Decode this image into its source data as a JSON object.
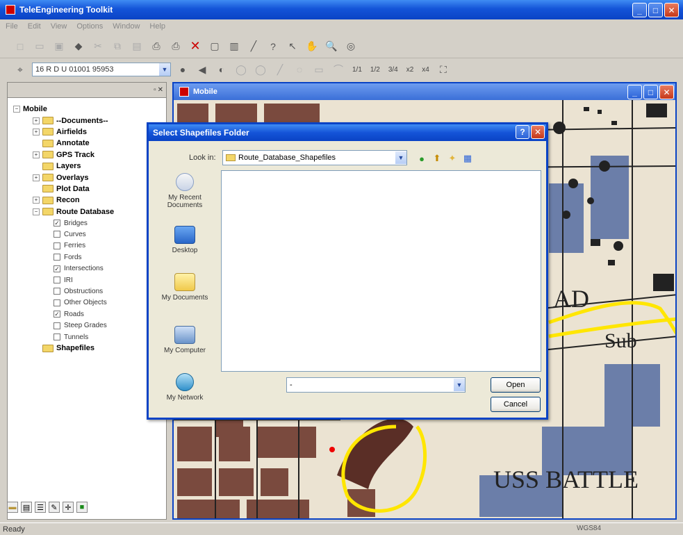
{
  "app": {
    "title": "TeleEngineering Toolkit",
    "menu": [
      "File",
      "Edit",
      "View",
      "Options",
      "Window",
      "Help"
    ]
  },
  "toolbar": {
    "grid_coordinate": "16 R D U 01001 95953",
    "zoom_levels": [
      "1/1",
      "1/2",
      "3/4",
      "x2",
      "x4"
    ]
  },
  "tree": {
    "root": "Mobile",
    "folders": [
      {
        "label": "--Documents--",
        "expandable": true
      },
      {
        "label": "Airfields",
        "expandable": true
      },
      {
        "label": "Annotate",
        "expandable": false
      },
      {
        "label": "GPS Track",
        "expandable": true
      },
      {
        "label": "Layers",
        "expandable": false
      },
      {
        "label": "Overlays",
        "expandable": true
      },
      {
        "label": "Plot Data",
        "expandable": false
      },
      {
        "label": "Recon",
        "expandable": true
      },
      {
        "label": "Route Database",
        "expandable": true,
        "expanded": true
      }
    ],
    "route_items": [
      {
        "label": "Bridges",
        "checked": true
      },
      {
        "label": "Curves",
        "checked": false
      },
      {
        "label": "Ferries",
        "checked": false
      },
      {
        "label": "Fords",
        "checked": false
      },
      {
        "label": "Intersections",
        "checked": true
      },
      {
        "label": "IRI",
        "checked": false
      },
      {
        "label": "Obstructions",
        "checked": false
      },
      {
        "label": "Other Objects",
        "checked": false
      },
      {
        "label": "Roads",
        "checked": true
      },
      {
        "label": "Steep Grades",
        "checked": false
      },
      {
        "label": "Tunnels",
        "checked": false
      }
    ],
    "last_folder": "Shapefiles"
  },
  "map_window": {
    "title": "Mobile",
    "labels": [
      "AD",
      "Sub",
      "USS BATTLE"
    ]
  },
  "dialog": {
    "title": "Select Shapefiles Folder",
    "look_in_label": "Look in:",
    "look_in_value": "Route_Database_Shapefiles",
    "places": [
      "My Recent Documents",
      "Desktop",
      "My Documents",
      "My Computer",
      "My Network"
    ],
    "filename_value": "-",
    "open_label": "Open",
    "cancel_label": "Cancel"
  },
  "status": {
    "left": "Ready",
    "right": "WGS84"
  }
}
